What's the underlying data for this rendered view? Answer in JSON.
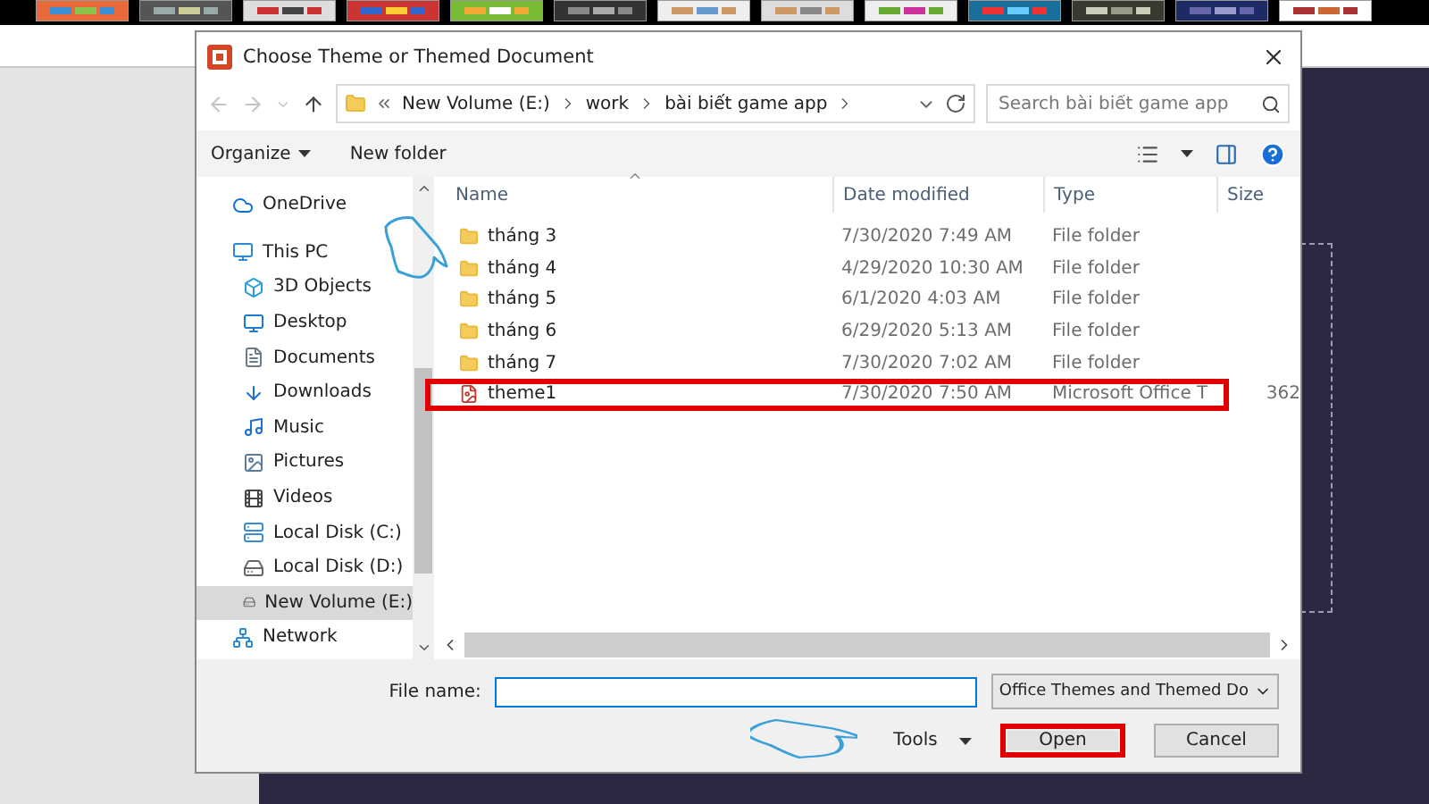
{
  "dialog": {
    "title": "Choose Theme or Themed Document",
    "history": [
      {
        "kind": "back",
        "disabled": true
      },
      {
        "kind": "forward",
        "disabled": true
      },
      {
        "kind": "recent",
        "disabled": true
      },
      {
        "kind": "up",
        "disabled": false
      }
    ],
    "breadcrumb": [
      "New Volume (E:)",
      "work",
      "bài biết game app"
    ],
    "search": {
      "placeholder": "Search bài biết game app"
    },
    "toolbar": [
      {
        "label": "Organize",
        "kind": "menu"
      },
      {
        "label": "New folder",
        "kind": "button"
      }
    ],
    "navigation": [
      {
        "label": "OneDrive",
        "kind": "cloud",
        "selected": false
      },
      {
        "label": "This PC",
        "kind": "computer",
        "selected": false,
        "children": [
          {
            "label": "3D Objects",
            "kind": "cube",
            "selected": false
          },
          {
            "label": "Desktop",
            "kind": "desktop",
            "selected": false
          },
          {
            "label": "Documents",
            "kind": "document",
            "selected": false
          },
          {
            "label": "Downloads",
            "kind": "download",
            "selected": false
          },
          {
            "label": "Music",
            "kind": "music",
            "selected": false
          },
          {
            "label": "Pictures",
            "kind": "picture",
            "selected": false
          },
          {
            "label": "Videos",
            "kind": "video",
            "selected": false
          },
          {
            "label": "Local Disk (C:)",
            "kind": "system-disk",
            "selected": false
          },
          {
            "label": "Local Disk (D:)",
            "kind": "disk",
            "selected": false
          },
          {
            "label": "New Volume (E:)",
            "kind": "disk",
            "selected": true
          }
        ]
      },
      {
        "label": "Network",
        "kind": "network",
        "selected": false
      }
    ],
    "columns": [
      "Name",
      "Date modified",
      "Type",
      "Size"
    ],
    "rows": [
      {
        "name": "tháng 3",
        "date": "7/30/2020 7:49 AM",
        "type": "File folder",
        "kind": "folder",
        "highlighted": false
      },
      {
        "name": "tháng 4",
        "date": "4/29/2020 10:30 AM",
        "type": "File folder",
        "kind": "folder",
        "highlighted": false
      },
      {
        "name": "tháng 5",
        "date": "6/1/2020 4:03 AM",
        "type": "File folder",
        "kind": "folder",
        "highlighted": false
      },
      {
        "name": "tháng 6",
        "date": "6/29/2020 5:13 AM",
        "type": "File folder",
        "kind": "folder",
        "highlighted": false
      },
      {
        "name": "tháng 7",
        "date": "7/30/2020 7:02 AM",
        "type": "File folder",
        "kind": "folder",
        "highlighted": false
      },
      {
        "name": "theme1",
        "date": "7/30/2020 7:50 AM",
        "type": "Microsoft Office T",
        "size": "362",
        "kind": "theme",
        "highlighted": true
      }
    ],
    "file_name": {
      "label": "File name:",
      "focused": true
    },
    "file_type": {
      "value": "Office Themes and Themed Do"
    },
    "buttons": [
      {
        "label": "Tools",
        "kind": "menu",
        "highlighted": false
      },
      {
        "label": "Open",
        "kind": "primary",
        "highlighted": true
      },
      {
        "label": "Cancel",
        "kind": "normal",
        "highlighted": false
      }
    ]
  }
}
